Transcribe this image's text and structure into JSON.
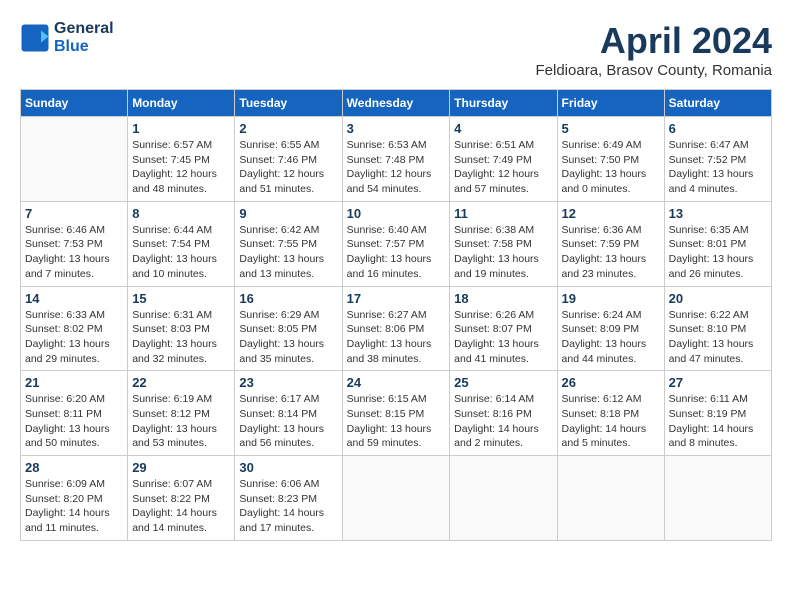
{
  "header": {
    "logo_line1": "General",
    "logo_line2": "Blue",
    "month_title": "April 2024",
    "subtitle": "Feldioara, Brasov County, Romania"
  },
  "weekdays": [
    "Sunday",
    "Monday",
    "Tuesday",
    "Wednesday",
    "Thursday",
    "Friday",
    "Saturday"
  ],
  "weeks": [
    [
      {
        "day": "",
        "info": ""
      },
      {
        "day": "1",
        "info": "Sunrise: 6:57 AM\nSunset: 7:45 PM\nDaylight: 12 hours\nand 48 minutes."
      },
      {
        "day": "2",
        "info": "Sunrise: 6:55 AM\nSunset: 7:46 PM\nDaylight: 12 hours\nand 51 minutes."
      },
      {
        "day": "3",
        "info": "Sunrise: 6:53 AM\nSunset: 7:48 PM\nDaylight: 12 hours\nand 54 minutes."
      },
      {
        "day": "4",
        "info": "Sunrise: 6:51 AM\nSunset: 7:49 PM\nDaylight: 12 hours\nand 57 minutes."
      },
      {
        "day": "5",
        "info": "Sunrise: 6:49 AM\nSunset: 7:50 PM\nDaylight: 13 hours\nand 0 minutes."
      },
      {
        "day": "6",
        "info": "Sunrise: 6:47 AM\nSunset: 7:52 PM\nDaylight: 13 hours\nand 4 minutes."
      }
    ],
    [
      {
        "day": "7",
        "info": "Sunrise: 6:46 AM\nSunset: 7:53 PM\nDaylight: 13 hours\nand 7 minutes."
      },
      {
        "day": "8",
        "info": "Sunrise: 6:44 AM\nSunset: 7:54 PM\nDaylight: 13 hours\nand 10 minutes."
      },
      {
        "day": "9",
        "info": "Sunrise: 6:42 AM\nSunset: 7:55 PM\nDaylight: 13 hours\nand 13 minutes."
      },
      {
        "day": "10",
        "info": "Sunrise: 6:40 AM\nSunset: 7:57 PM\nDaylight: 13 hours\nand 16 minutes."
      },
      {
        "day": "11",
        "info": "Sunrise: 6:38 AM\nSunset: 7:58 PM\nDaylight: 13 hours\nand 19 minutes."
      },
      {
        "day": "12",
        "info": "Sunrise: 6:36 AM\nSunset: 7:59 PM\nDaylight: 13 hours\nand 23 minutes."
      },
      {
        "day": "13",
        "info": "Sunrise: 6:35 AM\nSunset: 8:01 PM\nDaylight: 13 hours\nand 26 minutes."
      }
    ],
    [
      {
        "day": "14",
        "info": "Sunrise: 6:33 AM\nSunset: 8:02 PM\nDaylight: 13 hours\nand 29 minutes."
      },
      {
        "day": "15",
        "info": "Sunrise: 6:31 AM\nSunset: 8:03 PM\nDaylight: 13 hours\nand 32 minutes."
      },
      {
        "day": "16",
        "info": "Sunrise: 6:29 AM\nSunset: 8:05 PM\nDaylight: 13 hours\nand 35 minutes."
      },
      {
        "day": "17",
        "info": "Sunrise: 6:27 AM\nSunset: 8:06 PM\nDaylight: 13 hours\nand 38 minutes."
      },
      {
        "day": "18",
        "info": "Sunrise: 6:26 AM\nSunset: 8:07 PM\nDaylight: 13 hours\nand 41 minutes."
      },
      {
        "day": "19",
        "info": "Sunrise: 6:24 AM\nSunset: 8:09 PM\nDaylight: 13 hours\nand 44 minutes."
      },
      {
        "day": "20",
        "info": "Sunrise: 6:22 AM\nSunset: 8:10 PM\nDaylight: 13 hours\nand 47 minutes."
      }
    ],
    [
      {
        "day": "21",
        "info": "Sunrise: 6:20 AM\nSunset: 8:11 PM\nDaylight: 13 hours\nand 50 minutes."
      },
      {
        "day": "22",
        "info": "Sunrise: 6:19 AM\nSunset: 8:12 PM\nDaylight: 13 hours\nand 53 minutes."
      },
      {
        "day": "23",
        "info": "Sunrise: 6:17 AM\nSunset: 8:14 PM\nDaylight: 13 hours\nand 56 minutes."
      },
      {
        "day": "24",
        "info": "Sunrise: 6:15 AM\nSunset: 8:15 PM\nDaylight: 13 hours\nand 59 minutes."
      },
      {
        "day": "25",
        "info": "Sunrise: 6:14 AM\nSunset: 8:16 PM\nDaylight: 14 hours\nand 2 minutes."
      },
      {
        "day": "26",
        "info": "Sunrise: 6:12 AM\nSunset: 8:18 PM\nDaylight: 14 hours\nand 5 minutes."
      },
      {
        "day": "27",
        "info": "Sunrise: 6:11 AM\nSunset: 8:19 PM\nDaylight: 14 hours\nand 8 minutes."
      }
    ],
    [
      {
        "day": "28",
        "info": "Sunrise: 6:09 AM\nSunset: 8:20 PM\nDaylight: 14 hours\nand 11 minutes."
      },
      {
        "day": "29",
        "info": "Sunrise: 6:07 AM\nSunset: 8:22 PM\nDaylight: 14 hours\nand 14 minutes."
      },
      {
        "day": "30",
        "info": "Sunrise: 6:06 AM\nSunset: 8:23 PM\nDaylight: 14 hours\nand 17 minutes."
      },
      {
        "day": "",
        "info": ""
      },
      {
        "day": "",
        "info": ""
      },
      {
        "day": "",
        "info": ""
      },
      {
        "day": "",
        "info": ""
      }
    ]
  ]
}
